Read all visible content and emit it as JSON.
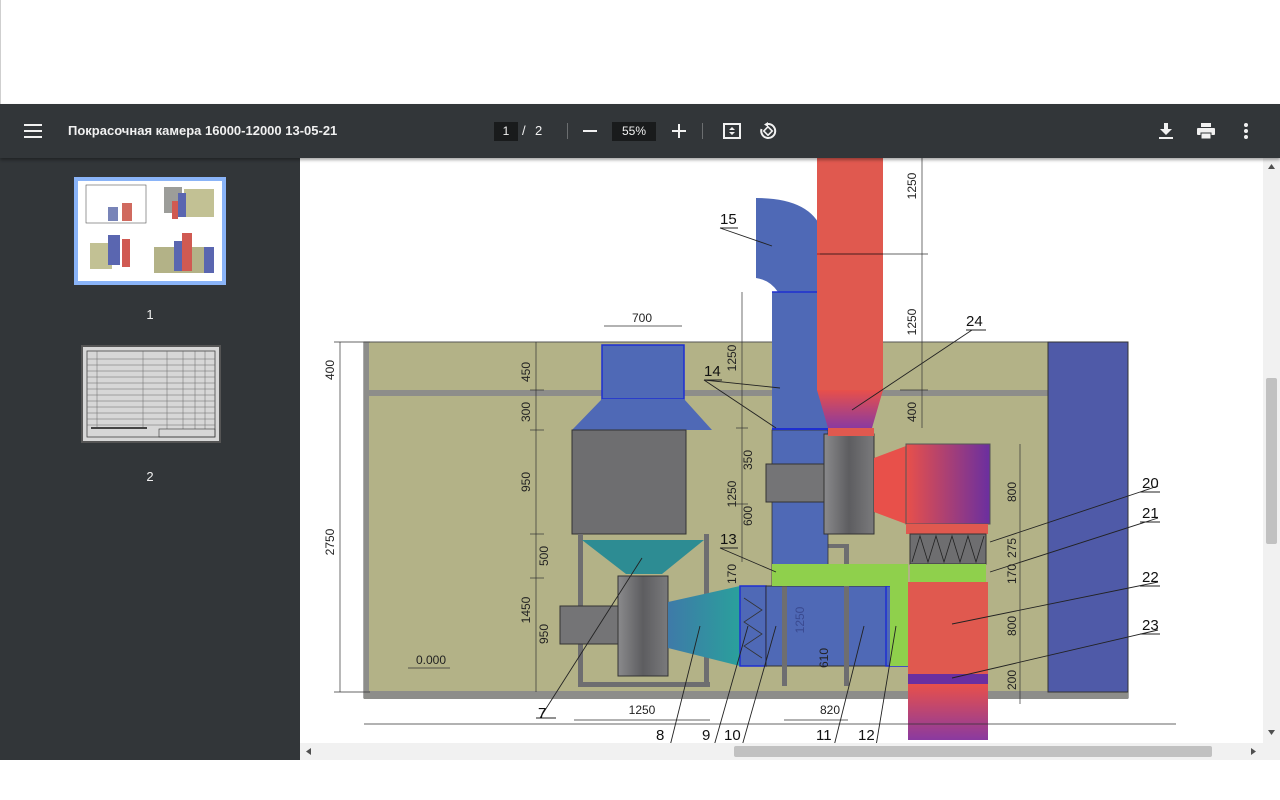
{
  "toolbar": {
    "title": "Покрасочная камера 16000-12000 13-05-21",
    "current_page": "1",
    "page_separator": "/",
    "total_pages": "2",
    "zoom": "55%"
  },
  "sidebar": {
    "pages": [
      {
        "label": "1",
        "selected": true
      },
      {
        "label": "2",
        "selected": false
      }
    ]
  },
  "drawing": {
    "dimensions": {
      "d700": "700",
      "d400": "400",
      "d450": "450",
      "d300": "300",
      "d950a": "950",
      "d500": "500",
      "d2750": "2750",
      "d1450": "1450",
      "d950b": "950",
      "d1250_top": "1250",
      "d1250_mid": "1250",
      "d1250_left": "1250",
      "d1250_v": "1250",
      "d400b": "400",
      "d350": "350",
      "d600": "600",
      "d170a": "170",
      "d800a": "800",
      "d275": "275",
      "d170b": "170",
      "d800b": "800",
      "d200": "200",
      "d1250_bottom": "1250",
      "d820": "820",
      "d1250_duct": "1250",
      "d610": "610",
      "elev": "0.000"
    },
    "callouts": {
      "c15": "15",
      "c14": "14",
      "c24": "24",
      "c13": "13",
      "c20": "20",
      "c21": "21",
      "c22": "22",
      "c23": "23",
      "c7": "7",
      "c8": "8",
      "c9": "9",
      "c10": "10",
      "c11": "11",
      "c12": "12"
    }
  },
  "colors": {
    "toolbar_bg": "#323639",
    "sidebar_bg": "#323639",
    "room_fill": "#b3b287",
    "duct_blue": "#4f69b6",
    "duct_red": "#e0594f",
    "fan_grey": "#6e6e70",
    "filter_green": "#8fd04c",
    "thumb_selected": "#8ab4f8"
  },
  "icons": {
    "menu": "menu-icon",
    "zoom_out": "minus-icon",
    "zoom_in": "plus-icon",
    "fit": "fit-page-icon",
    "rotate": "rotate-icon",
    "download": "download-icon",
    "print": "print-icon",
    "more": "more-vert-icon"
  }
}
